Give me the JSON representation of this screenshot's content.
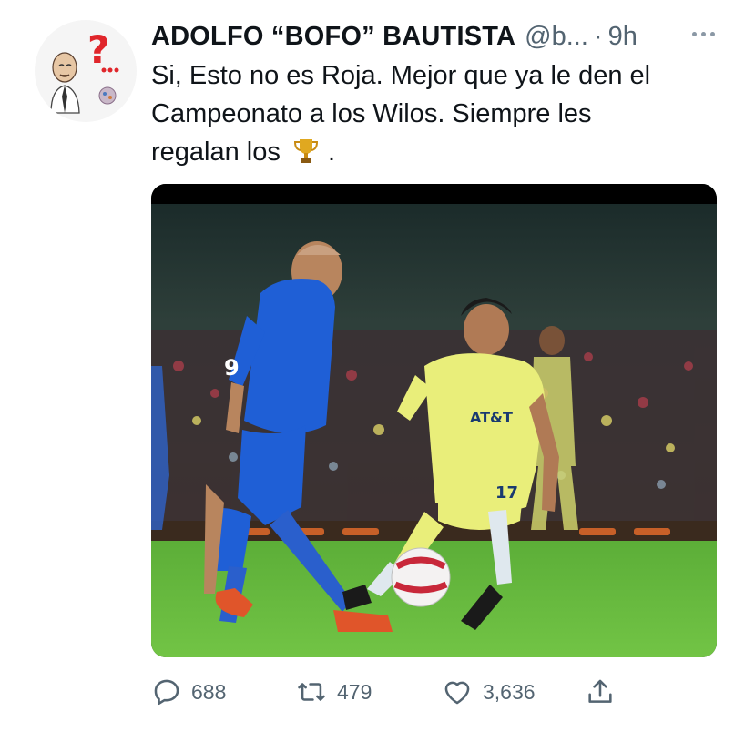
{
  "tweet": {
    "author_name": "ADOLFO “BOFO” BAUTISTA",
    "handle": "@b...",
    "separator": "·",
    "time": "9h",
    "text_line1": "Si, Esto no es Roja. Mejor que ya le den el",
    "text_line2": "Campeonato a los Wilos. Siempre les",
    "text_line3_before": "regalan los",
    "text_line3_after": ".",
    "emoji": "trophy"
  },
  "actions": {
    "replies": "688",
    "retweets": "479",
    "likes": "3,636"
  },
  "colors": {
    "text": "#0f1419",
    "muted": "#536471",
    "jersey_blue": "#1f5fd6",
    "jersey_yellow": "#e9ee7a",
    "pitch": "#5fb53a"
  },
  "icons": [
    "reply-icon",
    "retweet-icon",
    "like-icon",
    "share-icon",
    "more-icon",
    "trophy-icon"
  ]
}
